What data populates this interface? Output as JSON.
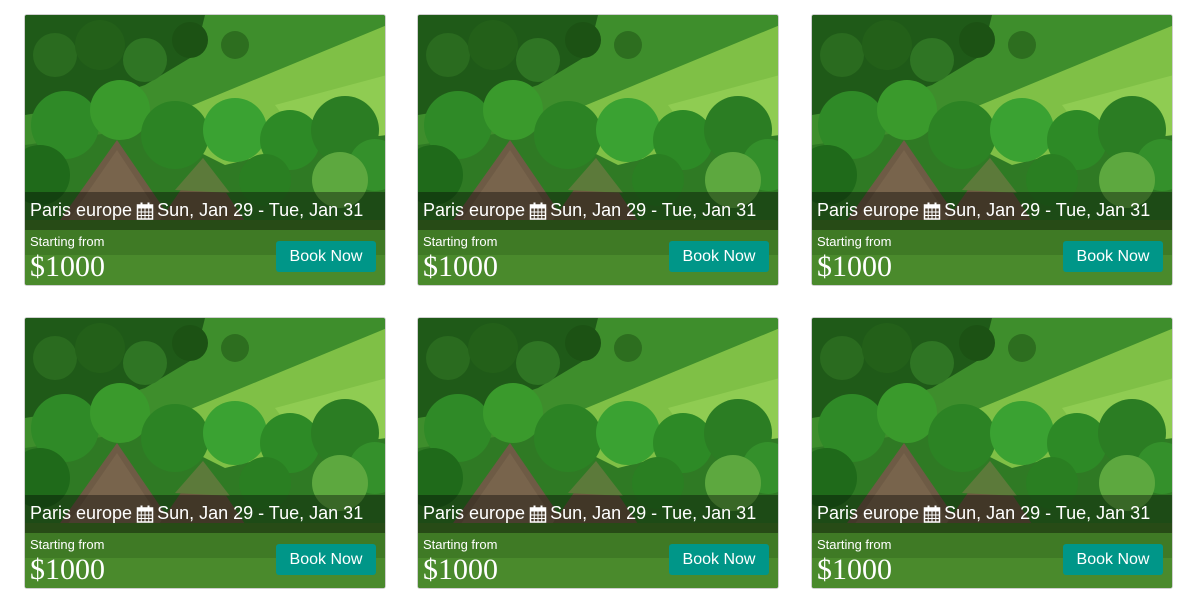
{
  "colors": {
    "button_bg": "#009688",
    "text": "#ffffff"
  },
  "cards": [
    {
      "destination": "Paris europe",
      "dates": "Sun, Jan 29 - Tue, Jan 31",
      "starting_label": "Starting from",
      "price": "$1000",
      "button_label": "Book Now",
      "icon": "calendar-icon"
    },
    {
      "destination": "Paris europe",
      "dates": "Sun, Jan 29 - Tue, Jan 31",
      "starting_label": "Starting from",
      "price": "$1000",
      "button_label": "Book Now",
      "icon": "calendar-icon"
    },
    {
      "destination": "Paris europe",
      "dates": "Sun, Jan 29 - Tue, Jan 31",
      "starting_label": "Starting from",
      "price": "$1000",
      "button_label": "Book Now",
      "icon": "calendar-icon"
    },
    {
      "destination": "Paris europe",
      "dates": "Sun, Jan 29 - Tue, Jan 31",
      "starting_label": "Starting from",
      "price": "$1000",
      "button_label": "Book Now",
      "icon": "calendar-icon"
    },
    {
      "destination": "Paris europe",
      "dates": "Sun, Jan 29 - Tue, Jan 31",
      "starting_label": "Starting from",
      "price": "$1000",
      "button_label": "Book Now",
      "icon": "calendar-icon"
    },
    {
      "destination": "Paris europe",
      "dates": "Sun, Jan 29 - Tue, Jan 31",
      "starting_label": "Starting from",
      "price": "$1000",
      "button_label": "Book Now",
      "icon": "calendar-icon"
    }
  ]
}
